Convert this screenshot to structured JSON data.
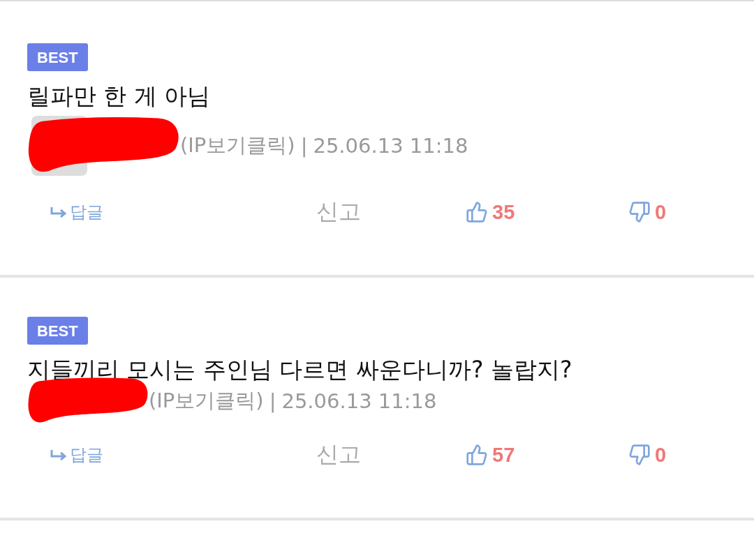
{
  "comments": [
    {
      "badge": "BEST",
      "text": "릴파만 한 게 아님",
      "avatar": true,
      "author_redacted": true,
      "ip_label": "(IP보기클릭)",
      "separator": "|",
      "date": "25.06.13 11:18",
      "reply": "답글",
      "report": "신고",
      "likes": "35",
      "dislikes": "0"
    },
    {
      "badge": "BEST",
      "text": "지들끼리 모시는 주인님 다르면 싸운다니까? 놀랍지?",
      "avatar": false,
      "author_redacted": true,
      "ip_label": "(IP보기클릭)",
      "separator": "|",
      "date": "25.06.13 11:18",
      "reply": "답글",
      "report": "신고",
      "likes": "57",
      "dislikes": "0"
    }
  ]
}
